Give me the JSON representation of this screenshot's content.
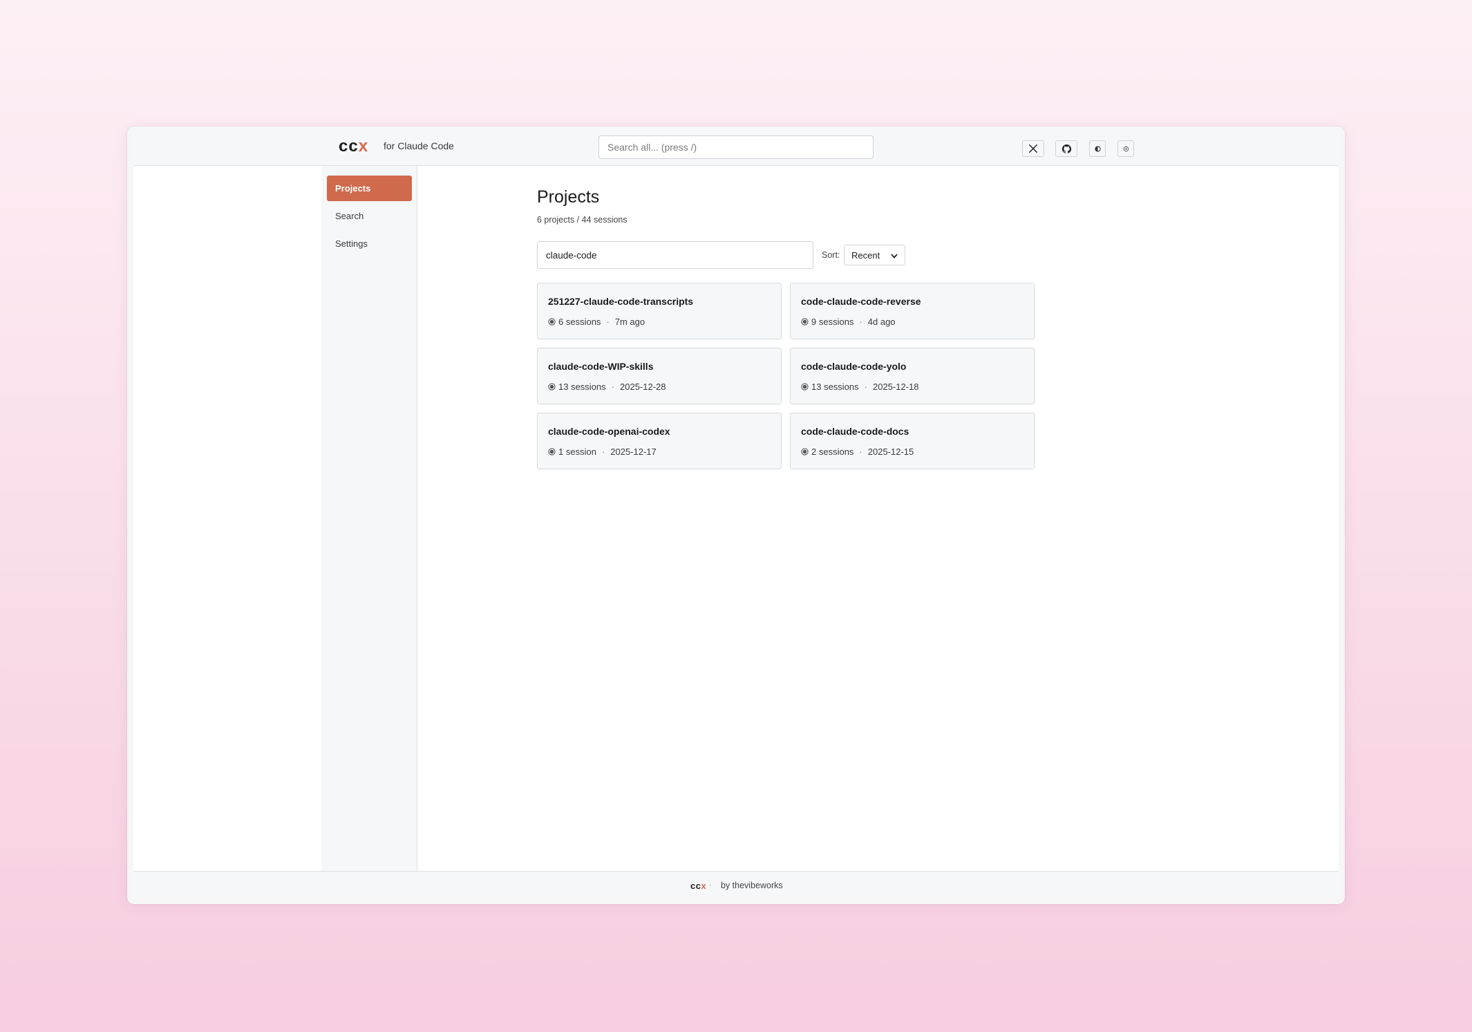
{
  "header": {
    "logo_part1": "cc",
    "logo_part2": "x",
    "tagline": "for Claude Code",
    "search_placeholder": "Search all... (press /)",
    "buttons": [
      {
        "icon": "x-twitter-icon"
      },
      {
        "icon": "github-icon"
      },
      {
        "icon": "theme-toggle-icon"
      },
      {
        "icon": "settings-gear-icon"
      }
    ]
  },
  "sidebar": {
    "items": [
      {
        "label": "Projects",
        "active": true
      },
      {
        "label": "Search",
        "active": false
      },
      {
        "label": "Settings",
        "active": false
      }
    ]
  },
  "main": {
    "title": "Projects",
    "subtitle": "6 projects / 44 sessions",
    "filter_value": "claude-code",
    "sort_label": "Sort:",
    "sort_value": "Recent",
    "projects": [
      {
        "name": "251227-claude-code-transcripts",
        "sessions": "6 sessions",
        "updated": "7m ago"
      },
      {
        "name": "code-claude-code-reverse",
        "sessions": "9 sessions",
        "updated": "4d ago"
      },
      {
        "name": "claude-code-WIP-skills",
        "sessions": "13 sessions",
        "updated": "2025-12-28"
      },
      {
        "name": "code-claude-code-yolo",
        "sessions": "13 sessions",
        "updated": "2025-12-18"
      },
      {
        "name": "claude-code-openai-codex",
        "sessions": "1 session",
        "updated": "2025-12-17"
      },
      {
        "name": "code-claude-code-docs",
        "sessions": "2 sessions",
        "updated": "2025-12-15"
      }
    ]
  },
  "footer": {
    "logo_part1": "cc",
    "logo_part2": "x",
    "separator": "·",
    "byline": "by thevibeworks"
  },
  "colors": {
    "accent": "#d06a4c",
    "background_top": "#fdf0f5",
    "background_bottom": "#f7cde1"
  }
}
